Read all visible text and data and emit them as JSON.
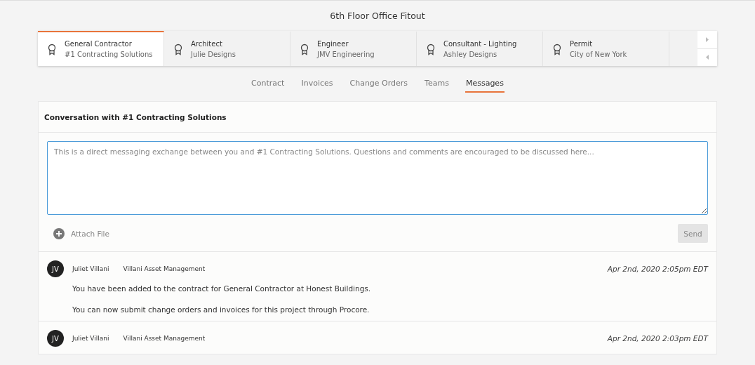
{
  "project_title": "6th Floor Office Fitout",
  "vendor_tabs": [
    {
      "role": "General Contractor",
      "company": "#1 Contracting Solutions",
      "selected": true
    },
    {
      "role": "Architect",
      "company": "Julie Designs",
      "selected": false
    },
    {
      "role": "Engineer",
      "company": "JMV Engineering",
      "selected": false
    },
    {
      "role": "Consultant - Lighting",
      "company": "Ashley Designs",
      "selected": false
    },
    {
      "role": "Permit",
      "company": "City of New York",
      "selected": false
    }
  ],
  "section_tabs": [
    {
      "label": "Contract",
      "selected": false
    },
    {
      "label": "Invoices",
      "selected": false
    },
    {
      "label": "Change Orders",
      "selected": false
    },
    {
      "label": "Teams",
      "selected": false
    },
    {
      "label": "Messages",
      "selected": true
    }
  ],
  "conversation": {
    "title": "Conversation with #1 Contracting Solutions",
    "message_field": {
      "placeholder": "This is a direct messaging exchange between you and #1 Contracting Solutions. Questions and comments are encouraged to be discussed here..."
    },
    "attach_label": "Attach File",
    "send_label": "Send",
    "send_disabled": true
  },
  "messages": [
    {
      "initials": "JV",
      "author": "Juliet Villani",
      "company": "Villani Asset Management",
      "timestamp": "Apr 2nd, 2020 2:05pm EDT",
      "paragraphs": [
        "You have been added to the contract for General Contractor at Honest Buildings.",
        "You can now submit change orders and invoices for this project through Procore."
      ]
    },
    {
      "initials": "JV",
      "author": "Juliet Villani",
      "company": "Villani Asset Management",
      "timestamp": "Apr 2nd, 2020 2:03pm EDT"
    }
  ]
}
